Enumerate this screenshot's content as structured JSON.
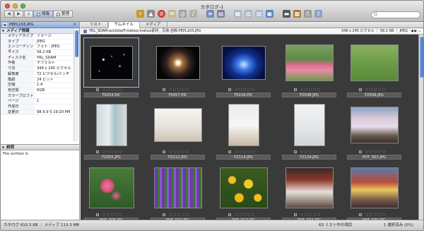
{
  "window": {
    "title": "カタログ-1"
  },
  "toolbar": {
    "mode_info": "情報",
    "mode_manage": "整理",
    "search_placeholder": "Q"
  },
  "colors": {
    "accent": "#3f72c4",
    "panel_header": "#8aa8d3",
    "grid_bg": "#3a3a3a"
  },
  "left_panel": {
    "file_name": "PEPL103.JPG",
    "section_title": "メディア情報",
    "metadata": [
      {
        "k": "メディアタイプ",
        "v": "イメージ"
      },
      {
        "k": "タイプ",
        "v": "JPEG"
      },
      {
        "k": "エンコーディング",
        "v": "フォト - JPEG"
      },
      {
        "k": "サイズ",
        "v": "58.2 KB"
      },
      {
        "k": "ディスク名",
        "v": "YRL_SDAM"
      },
      {
        "k": "作者",
        "v": "デフォルト"
      },
      {
        "k": "寸法",
        "v": "348 x 245 ピクセル"
      },
      {
        "k": "解像度",
        "v": "72 ピクセル/インチ"
      },
      {
        "k": "階調",
        "v": "24 ビット"
      },
      {
        "k": "圧縮",
        "v": "1:4"
      },
      {
        "k": "色空間",
        "v": "RGB"
      },
      {
        "k": "カラープロファイル",
        "v": ""
      },
      {
        "k": "ページ",
        "v": "1"
      },
      {
        "k": "作成日",
        "v": ""
      },
      {
        "k": "変更日",
        "v": "98.9.9 5:19:20 PM"
      }
    ],
    "notes_title": "説明",
    "notes_text": "File written b"
  },
  "tabs": [
    "リスト",
    "サムネイル",
    "メディア"
  ],
  "active_tab": 1,
  "path_bar": {
    "path": "YRL_SDAM:act2sta/F:matsui:matsui素材＿写真:自販:PEPL103.JPG",
    "info": "348 x 245 ピクセル ｜ 58.2 KB ｜ JPEG"
  },
  "thumbnails": [
    {
      "name": "FS054.PIC",
      "kind": "stars"
    },
    {
      "name": "FS057.PIC",
      "kind": "burst"
    },
    {
      "name": "FS134.PIC",
      "kind": "bluelight"
    },
    {
      "name": "FZ048.JPG",
      "kind": "garden"
    },
    {
      "name": "FZ049.JPG",
      "kind": "lawn"
    },
    {
      "name": "FZ055.JPG",
      "kind": "window"
    },
    {
      "name": "FZ112.JPG",
      "kind": "floor"
    },
    {
      "name": "FZ114.JPG",
      "kind": "desk"
    },
    {
      "name": "FZ124.JPG",
      "kind": "phone"
    },
    {
      "name": "PHT_001.JPG",
      "kind": "blossom"
    },
    {
      "name": "PHT_008.JPG",
      "kind": "flower"
    },
    {
      "name": "PHT_010.JPG",
      "kind": "iris"
    },
    {
      "name": "PHT_017.JPG",
      "kind": "sunflower"
    },
    {
      "name": "PHT_034.JPG",
      "kind": "festival"
    },
    {
      "name": "PHT_039.JPG",
      "kind": "float"
    }
  ],
  "status": {
    "left": "カタログ 810.3 KB ｜ メディア 113.3 MB",
    "center": "63 リスト中の項目",
    "right": "1 選択済み (0%)"
  }
}
